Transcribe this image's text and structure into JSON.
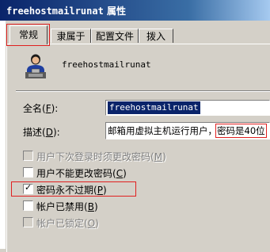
{
  "window": {
    "title_name": "freehostmailrunat",
    "title_suffix": "属性"
  },
  "tabs": [
    {
      "label": "常规",
      "active": true
    },
    {
      "label": "隶属于",
      "active": false
    },
    {
      "label": "配置文件",
      "active": false
    },
    {
      "label": "拨入",
      "active": false
    }
  ],
  "general": {
    "user_icon": "user-account-icon",
    "username": "freehostmailrunat",
    "fullname_label": "全名",
    "fullname_hotkey": "F",
    "fullname_value": "freehostmailrunat",
    "description_label": "描述",
    "description_hotkey": "D",
    "description_value_part1": "邮箱用虚拟主机运行用户，",
    "description_value_part2": "密码是40位"
  },
  "options": [
    {
      "label": "用户下次登录时须更改密码",
      "hotkey": "M",
      "checked": false,
      "enabled": false
    },
    {
      "label": "用户不能更改密码",
      "hotkey": "C",
      "checked": false,
      "enabled": true
    },
    {
      "label": "密码永不过期",
      "hotkey": "P",
      "checked": true,
      "enabled": true
    },
    {
      "label": "帐户已禁用",
      "hotkey": "B",
      "checked": false,
      "enabled": true
    },
    {
      "label": "帐户已锁定",
      "hotkey": "O",
      "checked": false,
      "enabled": false
    }
  ],
  "colors": {
    "highlight_annotation": "#e02020",
    "selection": "#0a246a",
    "dialog_face": "#d4d0c8"
  }
}
